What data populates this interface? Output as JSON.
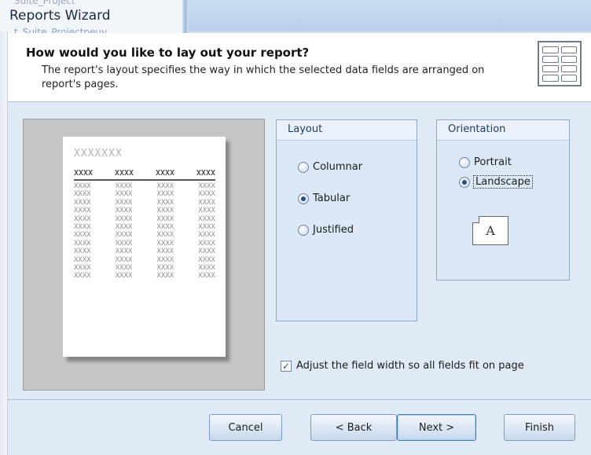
{
  "window": {
    "title": "Reports Wizard",
    "ghost_top": "Suite_Project",
    "ghost_second": "t_Suite_Projectpeuy"
  },
  "header": {
    "title": "How would you like to lay out your report?",
    "description": "The report's layout specifies the way in which the selected data fields are arranged on report's pages.",
    "icon": "report-layout-icon"
  },
  "preview": {
    "title": "XXXXXXX",
    "headers": [
      "XXXX",
      "XXXX",
      "XXXX",
      "XXXX"
    ],
    "row_cells": [
      "XXXX",
      "XXXX",
      "XXXX",
      "XXXX"
    ],
    "row_count": 12
  },
  "layout": {
    "group_label": "Layout",
    "options": [
      {
        "label": "Columnar",
        "checked": false
      },
      {
        "label": "Tabular",
        "checked": true
      },
      {
        "label": "Justified",
        "checked": false
      }
    ]
  },
  "orientation": {
    "group_label": "Orientation",
    "options": [
      {
        "label": "Portrait",
        "checked": false
      },
      {
        "label": "Landscape",
        "checked": true
      }
    ],
    "icon_letter": "A"
  },
  "fit_checkbox": {
    "label": "Adjust the field width so all fields fit on page",
    "checked": true
  },
  "buttons": {
    "cancel": "Cancel",
    "back": "< Back",
    "next": "Next >",
    "finish": "Finish"
  }
}
